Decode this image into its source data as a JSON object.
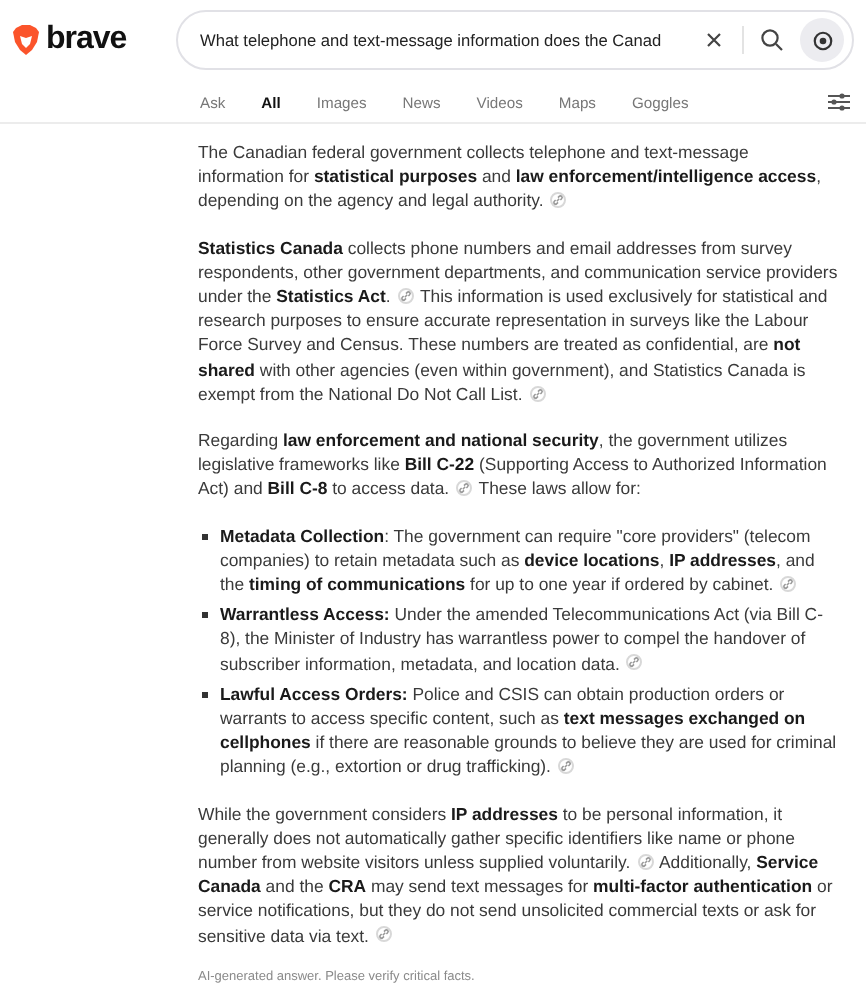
{
  "header": {
    "logo": "brave",
    "search": {
      "value": "What telephone and text-message information does the Canad"
    }
  },
  "tabs": [
    {
      "label": "Ask",
      "selected": false
    },
    {
      "label": "All",
      "selected": true
    },
    {
      "label": "Images",
      "selected": false
    },
    {
      "label": "News",
      "selected": false
    },
    {
      "label": "Videos",
      "selected": false
    },
    {
      "label": "Maps",
      "selected": false
    },
    {
      "label": "Goggles",
      "selected": false
    }
  ],
  "answer": [
    {
      "kind": "paragraph",
      "parts": [
        {
          "kind": "text",
          "text": "The Canadian federal government collects telephone and text-message information for **statistical purposes** and **law enforcement/intelligence access**, depending on the agency and legal authority."
        },
        {
          "kind": "citation"
        }
      ]
    },
    {
      "kind": "paragraph",
      "parts": [
        {
          "kind": "text",
          "text": "**Statistics Canada** collects phone numbers and email addresses from survey respondents, other government departments, and communication service providers under the **Statistics Act**."
        },
        {
          "kind": "citation"
        },
        {
          "kind": "text",
          "text": "This information is used exclusively for statistical and research purposes to ensure accurate representation in surveys like the Labour Force Survey and Census. These numbers are treated as confidential, are **not shared** with other agencies (even within government), and Statistics Canada is exempt from the National Do Not Call List."
        },
        {
          "kind": "citation"
        }
      ]
    },
    {
      "kind": "paragraph",
      "parts": [
        {
          "kind": "text",
          "text": "Regarding **law enforcement and national security**, the government utilizes legislative frameworks like **Bill C-22** (Supporting Access to Authorized Information Act) and **Bill C-8** to access data."
        },
        {
          "kind": "citation"
        },
        {
          "kind": "text",
          "text": "These laws allow for:"
        }
      ]
    },
    {
      "kind": "list",
      "items": [
        {
          "parts": [
            {
              "kind": "text",
              "text": "**Metadata Collection**: The government can require \"core providers\" (telecom companies) to retain metadata such as **device locations**, **IP addresses**, and the **timing of communications** for up to one year if ordered by cabinet."
            },
            {
              "kind": "citation"
            }
          ]
        },
        {
          "parts": [
            {
              "kind": "text",
              "text": "**Warrantless Access:** Under the amended Telecommunications Act (via Bill C-8), the Minister of Industry has warrantless power to compel the handover of subscriber information, metadata, and location data."
            },
            {
              "kind": "citation"
            }
          ]
        },
        {
          "parts": [
            {
              "kind": "text",
              "text": "**Lawful Access Orders:** Police and CSIS can obtain production orders or warrants to access specific content, such as **text messages exchanged on cellphones** if there are reasonable grounds to believe they are used for criminal planning (e.g., extortion or drug trafficking)."
            },
            {
              "kind": "citation"
            }
          ]
        }
      ]
    },
    {
      "kind": "paragraph",
      "parts": [
        {
          "kind": "text",
          "text": "While the government considers **IP addresses** to be personal information, it generally does not automatically gather specific identifiers like name or phone number from website visitors unless supplied voluntarily."
        },
        {
          "kind": "citation"
        },
        {
          "kind": "text",
          "text": "Additionally, **Service Canada** and the **CRA** may send text messages for **multi-factor authentication** or service notifications, but they do not send unsolicited commercial texts or ask for sensitive data via text."
        },
        {
          "kind": "citation"
        }
      ]
    }
  ],
  "disclaimer": "AI-generated answer. Please verify critical facts."
}
